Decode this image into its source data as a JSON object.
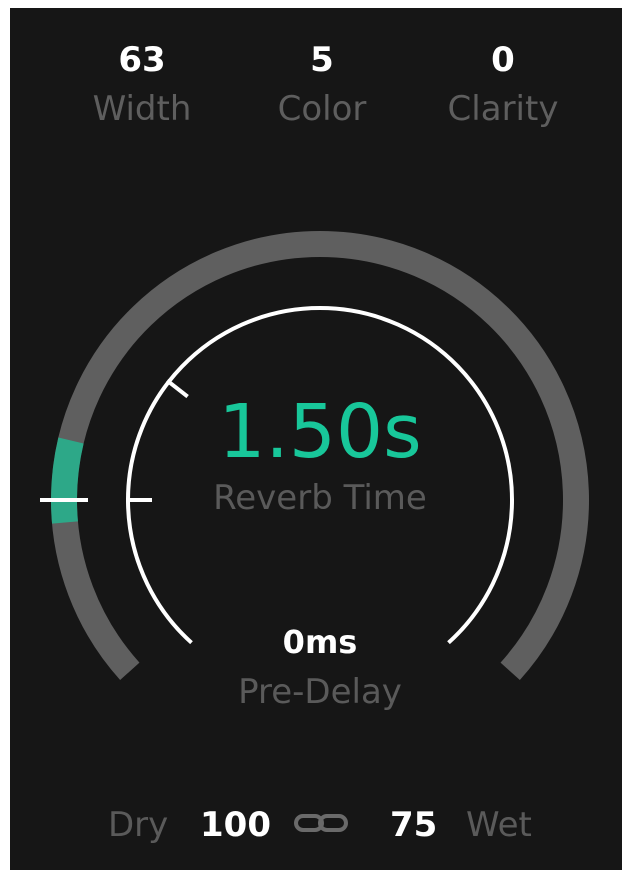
{
  "params": {
    "width": {
      "value": "63",
      "label": "Width"
    },
    "color": {
      "value": "5",
      "label": "Color"
    },
    "clarity": {
      "value": "0",
      "label": "Clarity"
    }
  },
  "reverb_time": {
    "value": "1.50s",
    "label": "Reverb Time",
    "level": 0.21
  },
  "pre_delay": {
    "value": "0ms",
    "label": "Pre-Delay"
  },
  "mix": {
    "dry_label": "Dry",
    "dry_value": "100",
    "wet_value": "75",
    "wet_label": "Wet",
    "link_icon": "link-chain-icon"
  },
  "colors": {
    "accent": "#18c79a",
    "track": "#5f5f5f",
    "background": "#161616"
  }
}
